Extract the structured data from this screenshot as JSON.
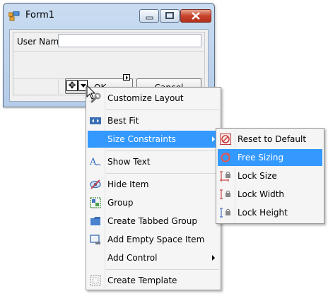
{
  "window": {
    "title": "Form1"
  },
  "form": {
    "user_name_label": "User Name",
    "user_name_value": "",
    "ok_label": "OK",
    "cancel_label": "Cancel"
  },
  "context_menu": {
    "items": [
      {
        "label": "Customize Layout",
        "icon": "wrench-icon"
      },
      {
        "label": "Best Fit",
        "icon": "best-fit-icon"
      },
      {
        "label": "Size Constraints",
        "icon": "",
        "highlighted": true,
        "submenu": true
      },
      {
        "label": "Show Text",
        "icon": "text-icon"
      },
      {
        "label": "Hide Item",
        "icon": "eye-icon"
      },
      {
        "label": "Group",
        "icon": "group-icon"
      },
      {
        "label": "Create Tabbed Group",
        "icon": "tabbed-folder-icon"
      },
      {
        "label": "Add Empty Space Item",
        "icon": "empty-space-icon"
      },
      {
        "label": "Add Control",
        "icon": "",
        "submenu": true
      },
      {
        "label": "Create Template",
        "icon": "template-icon"
      }
    ]
  },
  "size_constraints_menu": {
    "items": [
      {
        "label": "Reset to Default",
        "icon": "reset-icon"
      },
      {
        "label": "Free Sizing",
        "icon": "free-sizing-icon",
        "highlighted": true
      },
      {
        "label": "Lock Size",
        "icon": "lock-size-icon"
      },
      {
        "label": "Lock Width",
        "icon": "lock-width-icon"
      },
      {
        "label": "Lock Height",
        "icon": "lock-height-icon"
      }
    ]
  },
  "colors": {
    "highlight": "#3399ff",
    "menu_background": "#f5f5f5",
    "window_frame": "#b5cce8",
    "close_button": "#c9422c"
  }
}
